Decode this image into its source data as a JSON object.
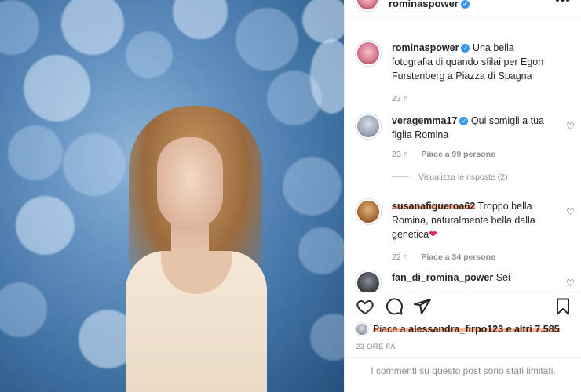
{
  "post": {
    "username": "rominaspower",
    "verified": true
  },
  "caption": {
    "username": "rominaspower",
    "text": "Una bella fotografia di quando sfilai per Egon Furstenberg a Piazza di Spagna",
    "time": "23 h"
  },
  "comments": [
    {
      "username": "veragemma17",
      "verified": true,
      "text": "Qui somigli a tua figlia Romina",
      "time": "23 h",
      "likes": "Piace a 99 persone",
      "replies": "Visualizza le risposte (2)"
    },
    {
      "username": "susanafigueroa62",
      "verified": false,
      "text": "Troppo bella Romina, naturalmente bella dalla genetica",
      "emoji": "❤",
      "time": "22 h",
      "likes": "Piace a 34 persone"
    },
    {
      "username": "fan_di_romina_power",
      "verified": false,
      "text": "Sei"
    }
  ],
  "likes_line": {
    "prefix": "Piace a ",
    "user": "alessandra_firpo123",
    "suffix": " e altri 7.585"
  },
  "date": "23 ORE FA",
  "limited_notice": "I commenti su questo post sono stati limitati.",
  "icons": [
    "more-options-icon",
    "heart-icon",
    "comment-icon",
    "share-icon",
    "bookmark-icon",
    "verified-icon"
  ],
  "colors": {
    "verified": "#3897f0",
    "highlight": "#ff8c5a",
    "secondary_text": "#8e8e8e"
  }
}
